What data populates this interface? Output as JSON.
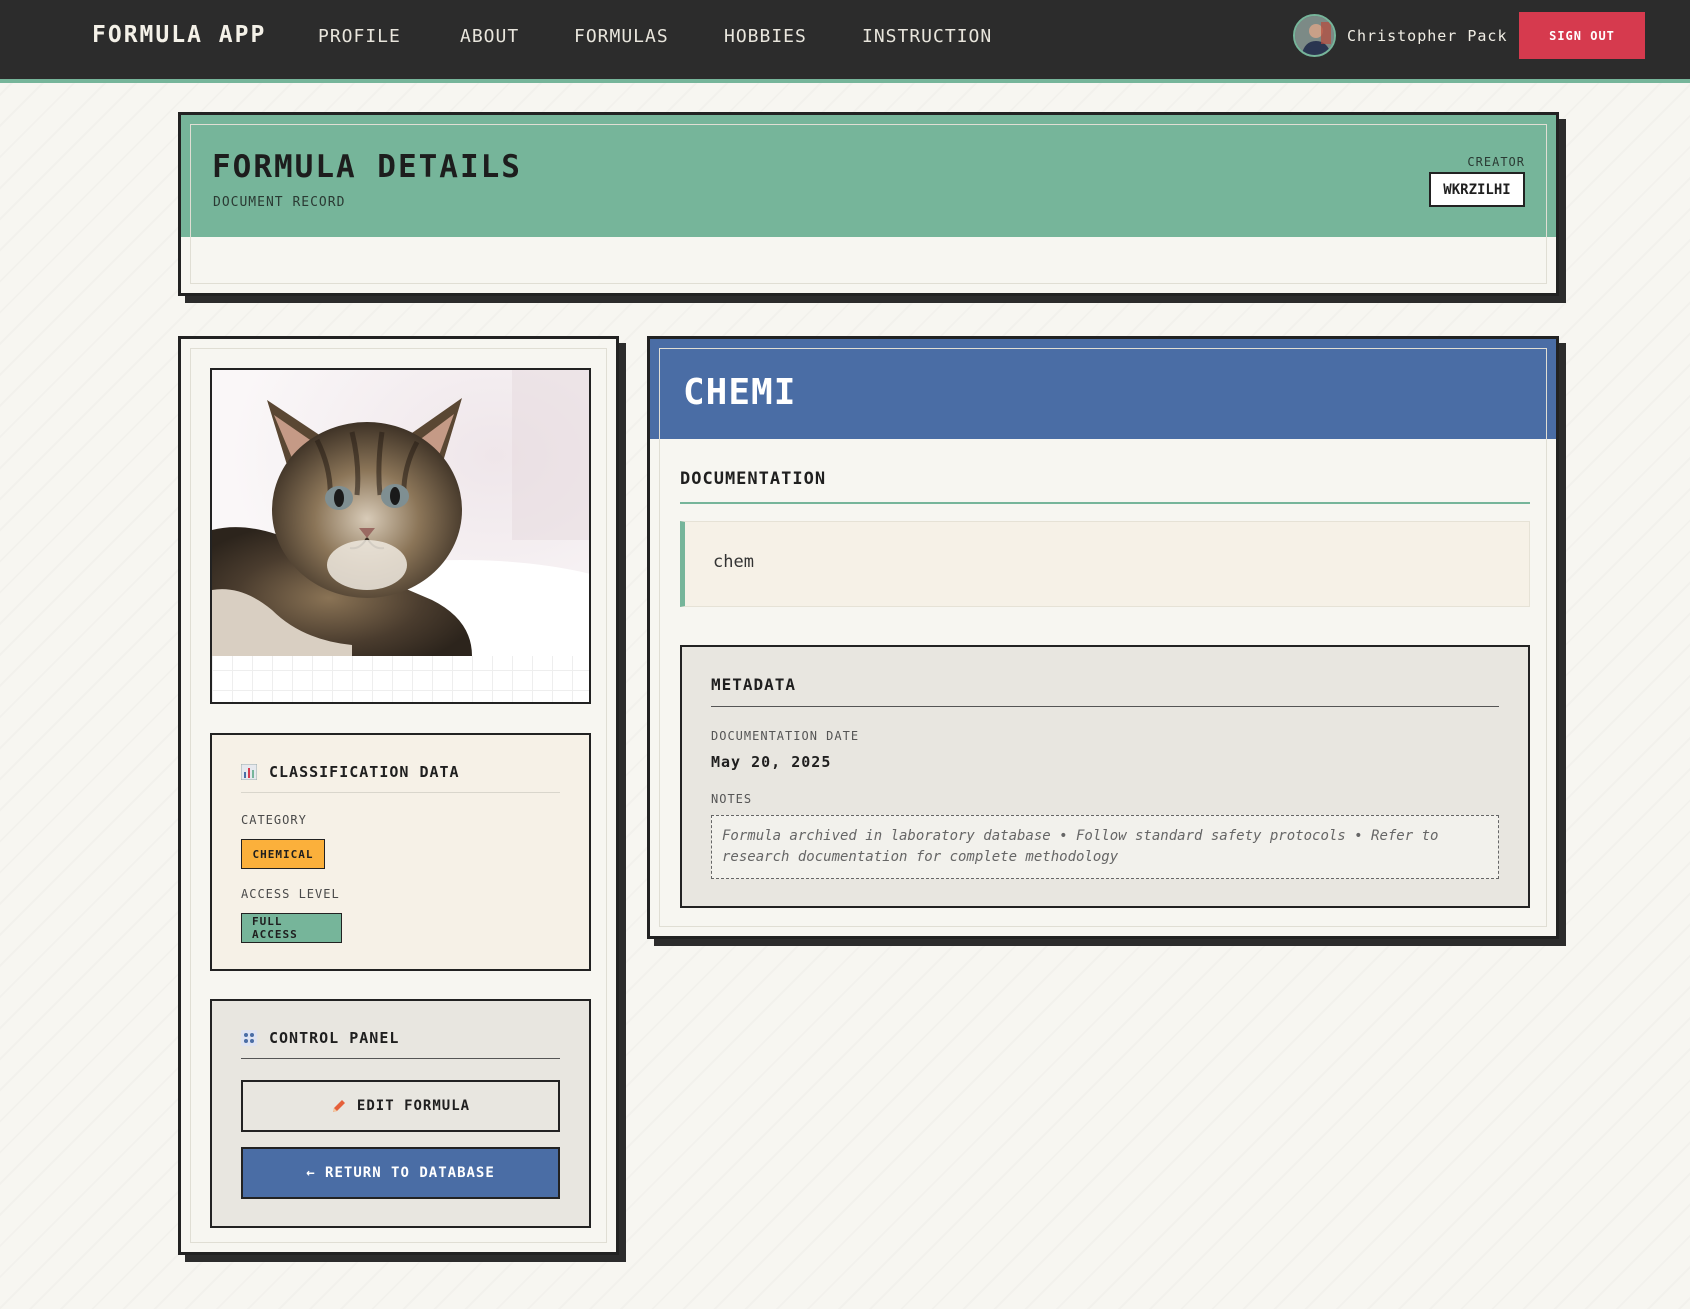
{
  "nav": {
    "brand": "FORMULA APP",
    "links": [
      "PROFILE",
      "ABOUT",
      "FORMULAS",
      "HOBBIES",
      "INSTRUCTION"
    ],
    "user_name": "Christopher Pack",
    "signout_label": "SIGN OUT"
  },
  "header": {
    "title": "FORMULA DETAILS",
    "subtitle": "DOCUMENT RECORD",
    "creator_label": "CREATOR",
    "creator_value": "WKRZILHI"
  },
  "classification": {
    "icon": "bar-chart-icon",
    "title": "CLASSIFICATION DATA",
    "category_label": "CATEGORY",
    "category_value": "CHEMICAL",
    "access_label": "ACCESS LEVEL",
    "access_value": "FULL ACCESS"
  },
  "control_panel": {
    "icon": "control-grid-icon",
    "title": "CONTROL PANEL",
    "edit_label": "EDIT FORMULA",
    "return_label": "← RETURN TO DATABASE"
  },
  "formula": {
    "name": "CHEMI",
    "documentation_heading": "DOCUMENTATION",
    "documentation_text": "chem"
  },
  "metadata": {
    "title": "METADATA",
    "date_label": "DOCUMENTATION DATE",
    "date_value": "May 20, 2025",
    "notes_label": "NOTES",
    "notes_text": "Formula archived in laboratory database • Follow standard safety protocols • Refer to research documentation for complete methodology"
  },
  "colors": {
    "nav_bg": "#2c2c2c",
    "accent_green": "#76b59a",
    "accent_blue": "#4a6da5",
    "signout_red": "#d63a4e",
    "category_orange": "#fbb03b"
  }
}
